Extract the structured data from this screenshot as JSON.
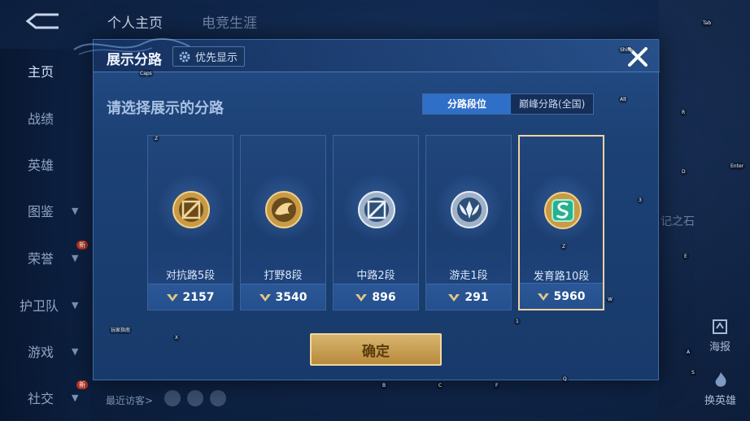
{
  "top_tabs": [
    "个人主页",
    "电竞生涯"
  ],
  "sidebar": {
    "items": [
      {
        "label": "主页",
        "chevron": false,
        "new": false
      },
      {
        "label": "战绩",
        "chevron": false,
        "new": false
      },
      {
        "label": "英雄",
        "chevron": false,
        "new": false
      },
      {
        "label": "图鉴",
        "chevron": true,
        "new": false
      },
      {
        "label": "荣誉",
        "chevron": true,
        "new": true
      },
      {
        "label": "护卫队",
        "chevron": true,
        "new": false
      },
      {
        "label": "游戏",
        "chevron": true,
        "new": false
      },
      {
        "label": "社交",
        "chevron": true,
        "new": true
      }
    ],
    "new_badge": "新"
  },
  "background": {
    "recent_visitors": "最近访客>",
    "right_poster": "海报",
    "right_switch_hero": "换英雄",
    "stone_text": "记之石"
  },
  "modal": {
    "title": "展示分路",
    "priority_label": "优先显示",
    "prompt": "请选择展示的分路",
    "tabs": [
      {
        "label": "分路段位",
        "active": true
      },
      {
        "label": "巅峰分路(全国)",
        "active": false
      }
    ],
    "cards": [
      {
        "tier": "对抗路5段",
        "points": "2157",
        "badge": "gold-slash",
        "selected": false
      },
      {
        "tier": "打野8段",
        "points": "3540",
        "badge": "gold-dragon",
        "selected": false
      },
      {
        "tier": "中路2段",
        "points": "896",
        "badge": "silver-slash",
        "selected": false
      },
      {
        "tier": "游走1段",
        "points": "291",
        "badge": "silver-wings",
        "selected": false
      },
      {
        "tier": "发育路10段",
        "points": "5960",
        "badge": "jade-s",
        "selected": true
      }
    ],
    "confirm_label": "确定"
  },
  "key_hints": {
    "caps": "Caps",
    "shift": "Shift",
    "alt": "Alt",
    "tab": "Tab",
    "enter": "Enter",
    "r": "R",
    "d": "D",
    "e": "E",
    "a": "A",
    "s": "S",
    "w": "W",
    "q": "Q",
    "z1": "Z",
    "z2": "Z",
    "x": "X",
    "b": "B",
    "c": "C",
    "f": "F",
    "n1": "1",
    "n3": "3",
    "guide": "玩家指南"
  },
  "colors": {
    "modal_bg": "#1c4175",
    "selected_border": "#f1d2a0",
    "active_tab": "#2f6fc8",
    "confirm_gold": "#c9a255"
  }
}
